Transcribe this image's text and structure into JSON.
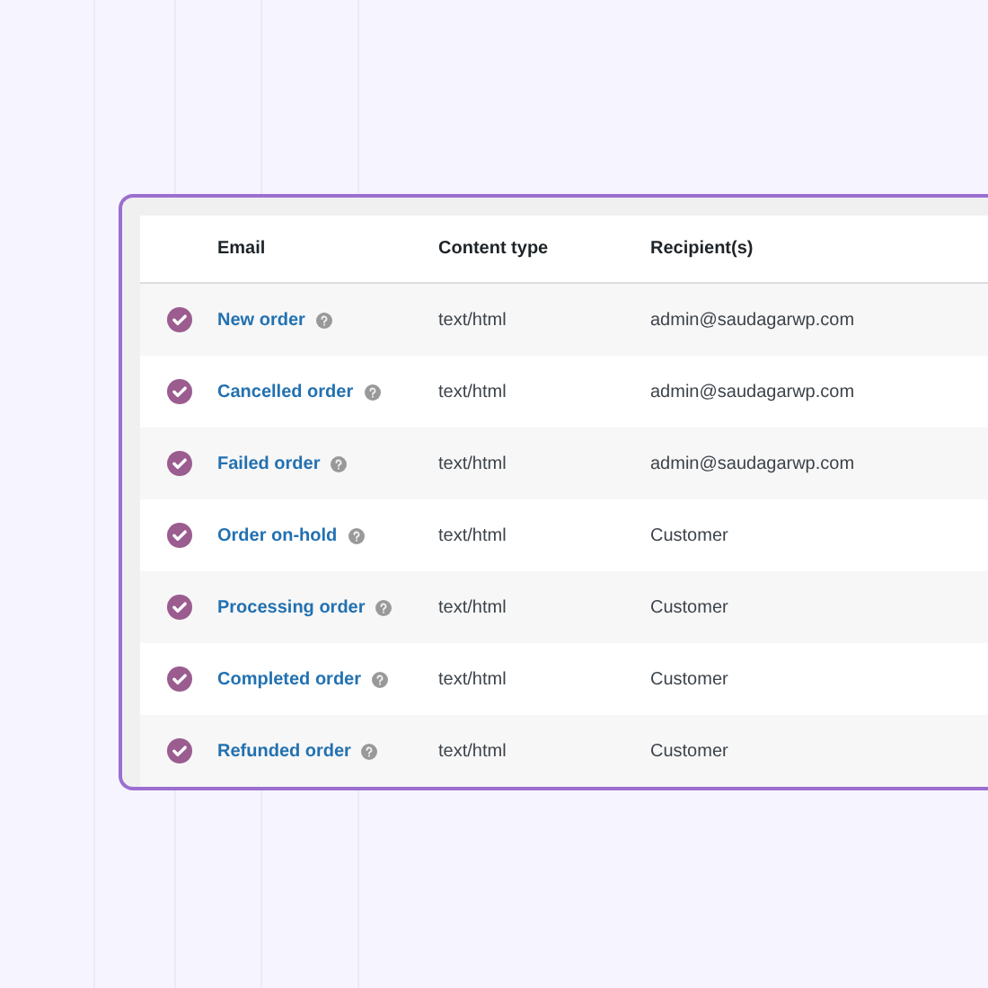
{
  "table": {
    "columns": [
      "Email",
      "Content type",
      "Recipient(s)"
    ],
    "rows": [
      {
        "email": "New order",
        "content_type": "text/html",
        "recipient": "admin@saudagarwp.com",
        "enabled": true
      },
      {
        "email": "Cancelled order",
        "content_type": "text/html",
        "recipient": "admin@saudagarwp.com",
        "enabled": true
      },
      {
        "email": "Failed order",
        "content_type": "text/html",
        "recipient": "admin@saudagarwp.com",
        "enabled": true
      },
      {
        "email": "Order on-hold",
        "content_type": "text/html",
        "recipient": "Customer",
        "enabled": true
      },
      {
        "email": "Processing order",
        "content_type": "text/html",
        "recipient": "Customer",
        "enabled": true
      },
      {
        "email": "Completed order",
        "content_type": "text/html",
        "recipient": "Customer",
        "enabled": true
      },
      {
        "email": "Refunded order",
        "content_type": "text/html",
        "recipient": "Customer",
        "enabled": true
      }
    ]
  }
}
